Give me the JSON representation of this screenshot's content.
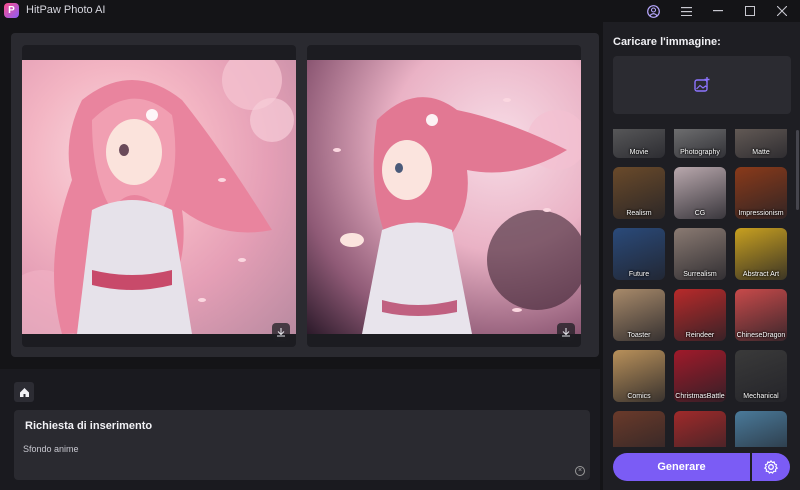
{
  "app": {
    "title": "HitPaw Photo AI",
    "logo_letter": "P",
    "accent_color": "#7b5cf5"
  },
  "titlebar": {
    "icons": [
      "user-icon",
      "menu-icon",
      "minimize-icon",
      "maximize-icon",
      "close-icon"
    ]
  },
  "canvas": {
    "images": [
      {
        "name": "generated-image-1",
        "download_icon": "download-icon"
      },
      {
        "name": "generated-image-2",
        "download_icon": "download-icon"
      }
    ]
  },
  "prompt": {
    "title": "Richiesta di inserimento",
    "text": "Sfondo anime"
  },
  "upload": {
    "label": "Caricare l'immagine:",
    "icon": "image-add-icon"
  },
  "styles": [
    {
      "label": "Movie",
      "color": "#6b6b6b"
    },
    {
      "label": "Photography",
      "color": "#8a8a8a"
    },
    {
      "label": "Matte",
      "color": "#7a6e66"
    },
    {
      "label": "Realism",
      "color": "#6a4a2a"
    },
    {
      "label": "CG",
      "color": "#b9a8ad"
    },
    {
      "label": "Impressionism",
      "color": "#8a3a1a"
    },
    {
      "label": "Future",
      "color": "#2a4a7a"
    },
    {
      "label": "Surrealism",
      "color": "#8a7a72"
    },
    {
      "label": "Abstract Art",
      "color": "#c8a020"
    },
    {
      "label": "Toaster",
      "color": "#a88a6a"
    },
    {
      "label": "Reindeer",
      "color": "#b82a2a"
    },
    {
      "label": "ChineseDragon",
      "color": "#c84a4a"
    },
    {
      "label": "Comics",
      "color": "#b8905a"
    },
    {
      "label": "ChristmasBattle",
      "color": "#a01a2a"
    },
    {
      "label": "Mechanical",
      "color": "#3a3a3a"
    },
    {
      "label": "",
      "color": "#6a3a2a"
    },
    {
      "label": "",
      "color": "#a02a2a"
    },
    {
      "label": "",
      "color": "#4a7a9a"
    }
  ],
  "actions": {
    "generate_label": "Generare",
    "settings_icon": "gear-icon"
  }
}
